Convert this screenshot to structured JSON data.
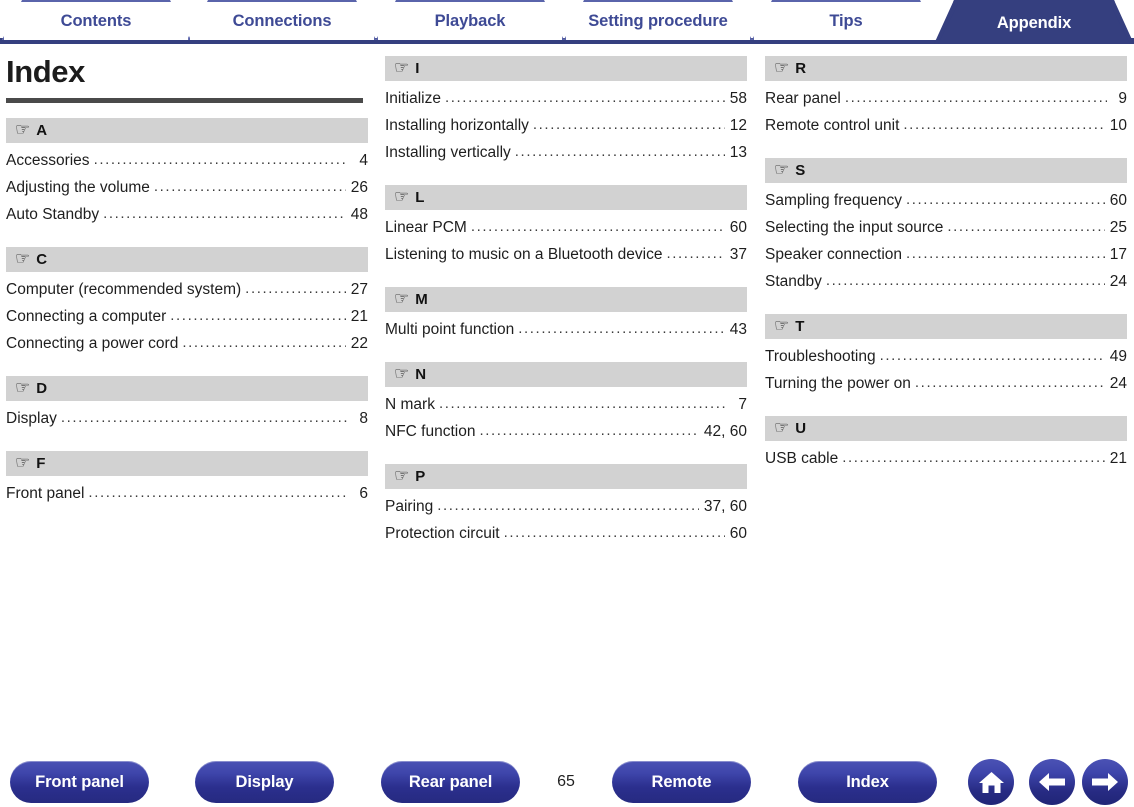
{
  "tabs": [
    {
      "label": "Contents",
      "active": false
    },
    {
      "label": "Connections",
      "active": false
    },
    {
      "label": "Playback",
      "active": false
    },
    {
      "label": "Setting procedure",
      "active": false
    },
    {
      "label": "Tips",
      "active": false
    },
    {
      "label": "Appendix",
      "active": true
    }
  ],
  "page": {
    "title": "Index",
    "number": "65"
  },
  "icons": {
    "hand": "☞",
    "home": "home-icon",
    "back": "arrow-left-icon",
    "next": "arrow-right-icon"
  },
  "colors": {
    "accent": "#353f7f",
    "tab_text": "#3e4a95",
    "section_header_bg": "#d2d2d2",
    "rule": "#4a4a4a",
    "pill_top": "#4b52b4",
    "pill_bottom": "#262a80"
  },
  "columns": [
    {
      "sections": [
        {
          "letter": "A",
          "entries": [
            {
              "title": "Accessories",
              "page": "4"
            },
            {
              "title": "Adjusting the volume",
              "page": "26"
            },
            {
              "title": "Auto Standby",
              "page": "48"
            }
          ]
        },
        {
          "letter": "C",
          "entries": [
            {
              "title": "Computer (recommended system)",
              "page": "27"
            },
            {
              "title": "Connecting a computer",
              "page": "21"
            },
            {
              "title": "Connecting a power cord",
              "page": "22"
            }
          ]
        },
        {
          "letter": "D",
          "entries": [
            {
              "title": "Display",
              "page": "8"
            }
          ]
        },
        {
          "letter": "F",
          "entries": [
            {
              "title": "Front panel",
              "page": "6"
            }
          ]
        }
      ]
    },
    {
      "sections": [
        {
          "letter": "I",
          "entries": [
            {
              "title": "Initialize",
              "page": "58"
            },
            {
              "title": "Installing horizontally",
              "page": "12"
            },
            {
              "title": "Installing vertically",
              "page": "13"
            }
          ]
        },
        {
          "letter": "L",
          "entries": [
            {
              "title": "Linear PCM",
              "page": "60"
            },
            {
              "title": "Listening to music on a Bluetooth device",
              "page": "37"
            }
          ]
        },
        {
          "letter": "M",
          "entries": [
            {
              "title": "Multi point function",
              "page": "43"
            }
          ]
        },
        {
          "letter": "N",
          "entries": [
            {
              "title": "N mark",
              "page": "7"
            },
            {
              "title": "NFC function",
              "page": "42, 60"
            }
          ]
        },
        {
          "letter": "P",
          "entries": [
            {
              "title": "Pairing",
              "page": "37, 60"
            },
            {
              "title": "Protection circuit",
              "page": "60"
            }
          ]
        }
      ]
    },
    {
      "sections": [
        {
          "letter": "R",
          "entries": [
            {
              "title": "Rear panel",
              "page": "9"
            },
            {
              "title": "Remote control unit",
              "page": "10"
            }
          ]
        },
        {
          "letter": "S",
          "entries": [
            {
              "title": "Sampling frequency",
              "page": "60"
            },
            {
              "title": "Selecting the input source",
              "page": "25"
            },
            {
              "title": "Speaker connection",
              "page": "17"
            },
            {
              "title": "Standby",
              "page": "24"
            }
          ]
        },
        {
          "letter": "T",
          "entries": [
            {
              "title": "Troubleshooting",
              "page": "49"
            },
            {
              "title": "Turning the power on",
              "page": "24"
            }
          ]
        },
        {
          "letter": "U",
          "entries": [
            {
              "title": "USB cable",
              "page": "21"
            }
          ]
        }
      ]
    }
  ],
  "bottom_nav": {
    "pills": [
      {
        "id": "front",
        "label": "Front panel"
      },
      {
        "id": "display",
        "label": "Display"
      },
      {
        "id": "rear",
        "label": "Rear panel"
      },
      {
        "id": "remote",
        "label": "Remote"
      },
      {
        "id": "index",
        "label": "Index"
      }
    ]
  }
}
